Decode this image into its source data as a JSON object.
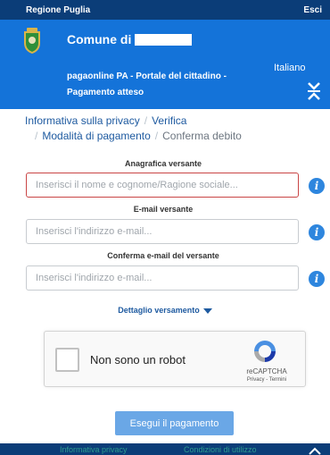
{
  "topbar": {
    "region": "Regione Puglia",
    "exit": "Esci"
  },
  "header": {
    "comune": "Comune di",
    "portal": "pagaonline PA - Portale del cittadino -",
    "subtitle": "Pagamento atteso",
    "language": "Italiano"
  },
  "breadcrumb": {
    "items": [
      "Informativa sulla privacy",
      "Verifica",
      "Modalità di pagamento",
      "Conferma debito"
    ]
  },
  "form": {
    "anagrafica": {
      "label": "Anagrafica versante",
      "placeholder": "Inserisci il nome e cognome/Ragione sociale..."
    },
    "email": {
      "label": "E-mail versante",
      "placeholder": "Inserisci l'indirizzo e-mail..."
    },
    "email_confirm": {
      "label": "Conferma e-mail del versante",
      "placeholder": "Inserisci l'indirizzo e-mail..."
    }
  },
  "dettaglio": "Dettaglio versamento",
  "captcha": {
    "label": "Non sono un robot",
    "brand": "reCAPTCHA",
    "links": "Privacy - Termini"
  },
  "pay_button": "Esegui il pagamento",
  "footer": {
    "privacy": "Informativa privacy",
    "terms": "Condizioni di utilizzo"
  },
  "colors": {
    "header_blue": "#1473d9",
    "topbar_navy": "#0b3d78",
    "link_blue": "#1e5aa0",
    "error_red": "#c94545",
    "info_blue": "#2e86de"
  },
  "icons": {
    "crest": "municipal-crest-icon",
    "collapse": "collapse-arrows-icon",
    "info": "info-icon",
    "caret": "caret-down-icon",
    "recaptcha": "recaptcha-logo-icon"
  }
}
